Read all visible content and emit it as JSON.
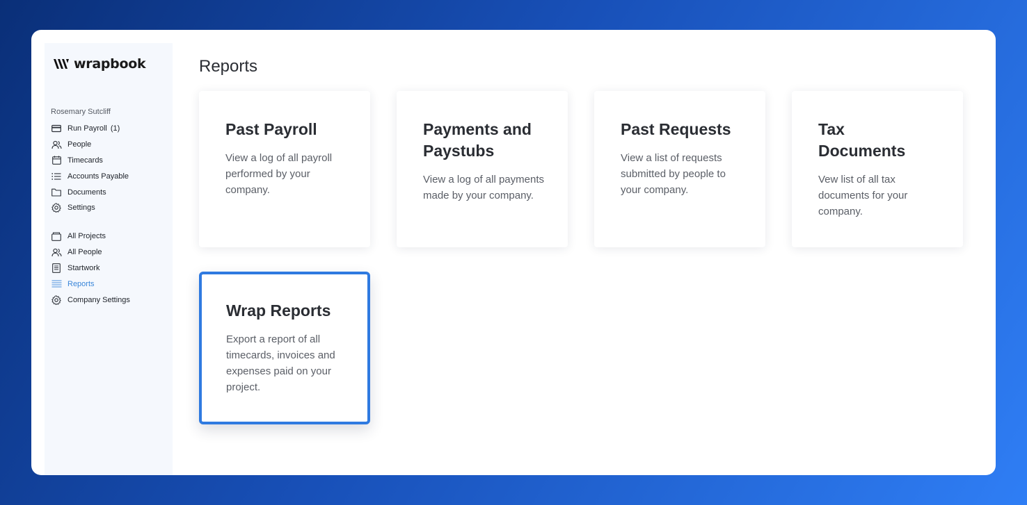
{
  "app": {
    "brand": "wrapbook"
  },
  "sidebar": {
    "user_name": "Rosemary Sutcliff",
    "group1": [
      {
        "label": "Run Payroll",
        "count": "(1)",
        "icon": "credit-card-icon"
      },
      {
        "label": "People",
        "icon": "people-icon"
      },
      {
        "label": "Timecards",
        "icon": "calendar-icon"
      },
      {
        "label": "Accounts Payable",
        "icon": "list-icon"
      },
      {
        "label": "Documents",
        "icon": "folder-icon"
      },
      {
        "label": "Settings",
        "icon": "gear-icon"
      }
    ],
    "group2": [
      {
        "label": "All Projects",
        "icon": "briefcase-icon"
      },
      {
        "label": "All People",
        "icon": "people-icon"
      },
      {
        "label": "Startwork",
        "icon": "document-icon"
      },
      {
        "label": "Reports",
        "icon": "reports-icon",
        "active": true
      },
      {
        "label": "Company Settings",
        "icon": "gear-icon"
      }
    ]
  },
  "main": {
    "title": "Reports",
    "cards": [
      {
        "title": "Past Payroll",
        "description": "View a log of all payroll performed by your company."
      },
      {
        "title": "Payments and Paystubs",
        "description": "View a log of all payments made by your company."
      },
      {
        "title": "Past Requests",
        "description": "View a list of requests submitted by people to your company."
      },
      {
        "title": "Tax Documents",
        "description": "Vew list of all tax documents for your company."
      },
      {
        "title": "Wrap Reports",
        "description": "Export a report of all timecards, invoices and expenses paid on your project.",
        "selected": true
      }
    ]
  },
  "colors": {
    "accent": "#2f7ae0",
    "active_nav": "#3a86d9",
    "background_start": "#0a2f78",
    "background_end": "#2f7ef5"
  }
}
